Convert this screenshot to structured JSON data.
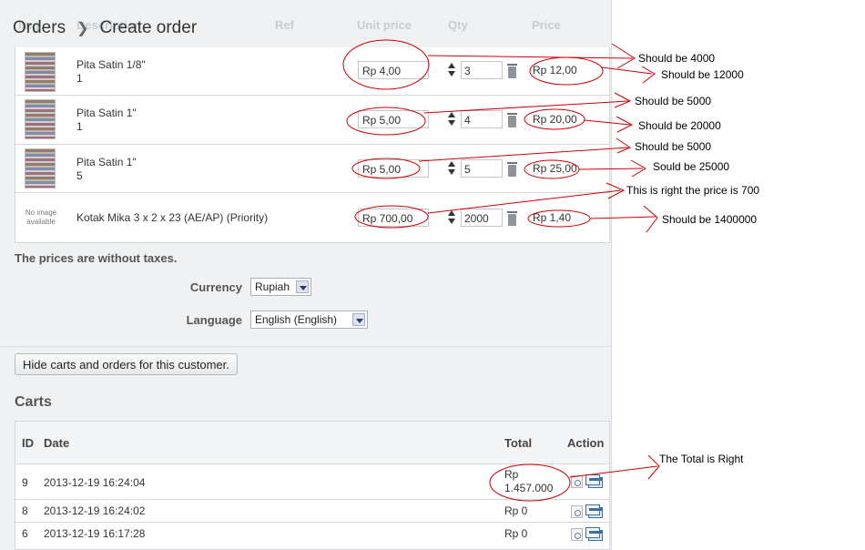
{
  "header": {
    "breadcrumb_parent": "Orders",
    "breadcrumb_current": "Create order",
    "ghost_columns": [
      "Img",
      "Description",
      "Ref",
      "Unit price",
      "Qty",
      "Price"
    ]
  },
  "products": [
    {
      "name": "Pita Satin 1/8\"",
      "attr": "1",
      "unit_price": "Rp 4,00",
      "qty": "3",
      "price": "Rp 12,00",
      "image": "satin-ribbon-thumbnail"
    },
    {
      "name": "Pita Satin 1\"",
      "attr": "1",
      "unit_price": "Rp 5,00",
      "qty": "4",
      "price": "Rp 20,00",
      "image": "satin-ribbon-thumbnail"
    },
    {
      "name": "Pita Satin 1\"",
      "attr": "5",
      "unit_price": "Rp 5,00",
      "qty": "5",
      "price": "Rp 25,00",
      "image": "satin-ribbon-thumbnail"
    },
    {
      "name": "Kotak Mika 3 x 2 x 23 (AE/AP) (Priority)",
      "attr": "",
      "unit_price": "Rp 700,00",
      "qty": "2000",
      "price": "Rp 1,40",
      "image_text": "No image available"
    }
  ],
  "taxes_note": "The prices are without taxes.",
  "currency": {
    "label": "Currency",
    "value": "Rupiah"
  },
  "language": {
    "label": "Language",
    "value": "English (English)"
  },
  "hide_button": "Hide carts and orders for this customer.",
  "carts": {
    "title": "Carts",
    "columns": {
      "id": "ID",
      "date": "Date",
      "total": "Total",
      "action": "Action"
    },
    "rows": [
      {
        "id": "9",
        "date": "2013-12-19 16:24:04",
        "total_line1": "Rp",
        "total_line2": "1.457.000"
      },
      {
        "id": "8",
        "date": "2013-12-19 16:24:02",
        "total_line1": "Rp 0",
        "total_line2": ""
      },
      {
        "id": "6",
        "date": "2013-12-19 16:17:28",
        "total_line1": "Rp 0",
        "total_line2": ""
      }
    ]
  },
  "annotations": {
    "note1": "Should be 4000",
    "note2": "Should be 12000",
    "note3": "Should be 5000",
    "note4": "Should be 20000",
    "note5": "Should be 5000",
    "note6": "Sould be 25000",
    "note7": "This is right the price is  700",
    "note8": "Should be 1400000",
    "note9": "The Total is Right",
    "color": "#cc0000"
  }
}
